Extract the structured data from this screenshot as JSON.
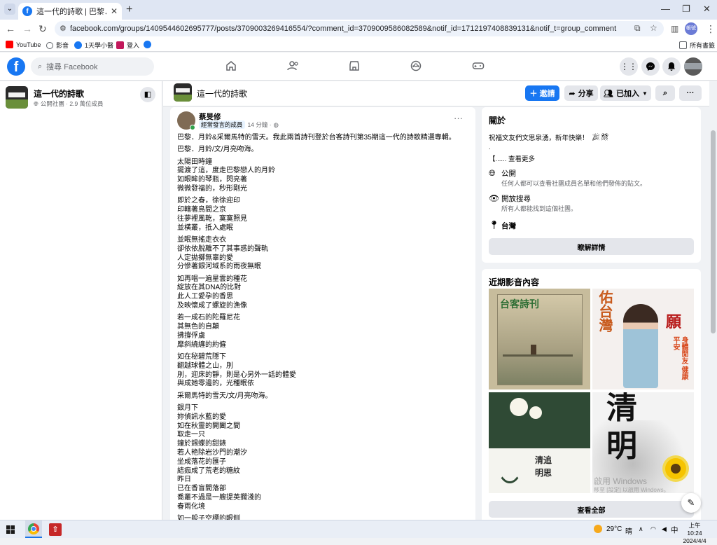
{
  "browser": {
    "tab_title": "這一代的詩歌 | 巴黎．月鈴&采",
    "tab_close": "✕",
    "new_tab": "+",
    "url": "facebook.com/groups/1409544602695777/posts/3709003269416554/?comment_id=3709009586082589&notif_id=1712197408839131&notif_t=group_comment",
    "profile_label": "帳號",
    "bookmarks": [
      {
        "label": "YouTube",
        "color": "#ff0000"
      },
      {
        "label": "影音",
        "color": "#5f6368"
      },
      {
        "label": "1天學小醫",
        "color": "#1877f2"
      },
      {
        "label": "登入",
        "color": "#c2185b"
      },
      {
        "label": "",
        "color": "#1877f2"
      }
    ],
    "all_bookmarks": "所有書籤"
  },
  "fb": {
    "logo": "f",
    "search_placeholder": "搜尋 Facebook"
  },
  "group": {
    "name": "這一代的詩歌",
    "meta": "公開社團 · 2.9 萬位成員",
    "invite_label": "＋ 邀請",
    "share_label": "分享",
    "joined_label": "已加入"
  },
  "post": {
    "author": "蔡旻修",
    "badge": "經常發言的成員",
    "time": "14 分鐘 ·",
    "more": "···",
    "paragraphs": [
      "巴黎．月鈴&采爾馬特的雪天。我此兩首詩刊登於台客詩刊第35期這一代的詩歌精選專輯。",
      "巴黎．月鈴/文/月亮吻海。",
      "太陽田時鐘\n擺渡了這，度走巴黎戀人的月鈴\n如眼眸的琴瓶，閃亮著\n微微發福的，秒形剛光",
      "即於之春，徐徐迎印\n印轄著鳥間之京\n往夢裡風乾，寞寞照見\n並橫叢，抵入處眠",
      "並眠無搖走衣衣\n卻依依脫離不了其事惑的聲軌\n人定拋擲無辜的愛\n分慘著銀河域系的雨夜無眠",
      "如再唱一遍星雲的種花\n綻放在其DNA的比對\n此人工愛孕的香思\n及映懷成了螺旋的漁像",
      "若一成石的陀羅尼花\n其無色的自顛\n拂撐俘虜\n靡斜繞纏的約僱",
      "如在秘碧荒隱下\n翻越球體之山，刖\n刖，迎床的靜，則是心另外一話的體愛\n與成她零邊的，光種眠依",
      "采爾馬特的雪天/文/月亮吻海。",
      "銀月下\n妳偵訊水藍的愛\n如在秋靈的開闔之間\n取走一只\n鐘於錫蝶的甜錶\n若人艳除岩沙門的潮汐\n坐成落花的匯子\n結痂成了荒老的糖紋\n昨日\n已在香盲間落部\n喬叢不過是一艘提英擱淺的\n春雨化境",
      "如一般子空標的眼釧"
    ]
  },
  "about": {
    "title": "關於",
    "desc": "祝福文友們文思泉湧，新年快樂！",
    "dot": ".",
    "see_more": "【...... 查看更多",
    "public_title": "公開",
    "public_desc": "任何人都可以查看社團成員名單和他們發佈的貼文。",
    "visible_title": "開放搜尋",
    "visible_desc": "所有人都能找到這個社團。",
    "location": "台灣",
    "learn_more": "瞭解詳情"
  },
  "media": {
    "title": "近期影音內容",
    "tile1_title": "台客詩刊",
    "tile2_top": "佑台灣",
    "tile2_big": "願",
    "tile2_sub": "身體閒友 健康平安",
    "tile3_title": "清追\n明思",
    "tile4_big": "清\n明",
    "see_all": "查看全部",
    "watermark1": "啟用 Windows",
    "watermark2": "移至 [設定] 以啟用 Windows。"
  },
  "taskbar": {
    "temp": "29°C",
    "weather": "晴",
    "ime": "中",
    "time": "上午 10:24",
    "date": "2024/4/4"
  },
  "icons": {
    "home": "home-icon",
    "friends": "friends-icon",
    "marketplace": "marketplace-icon",
    "groups": "groups-icon",
    "gaming": "gaming-icon"
  }
}
